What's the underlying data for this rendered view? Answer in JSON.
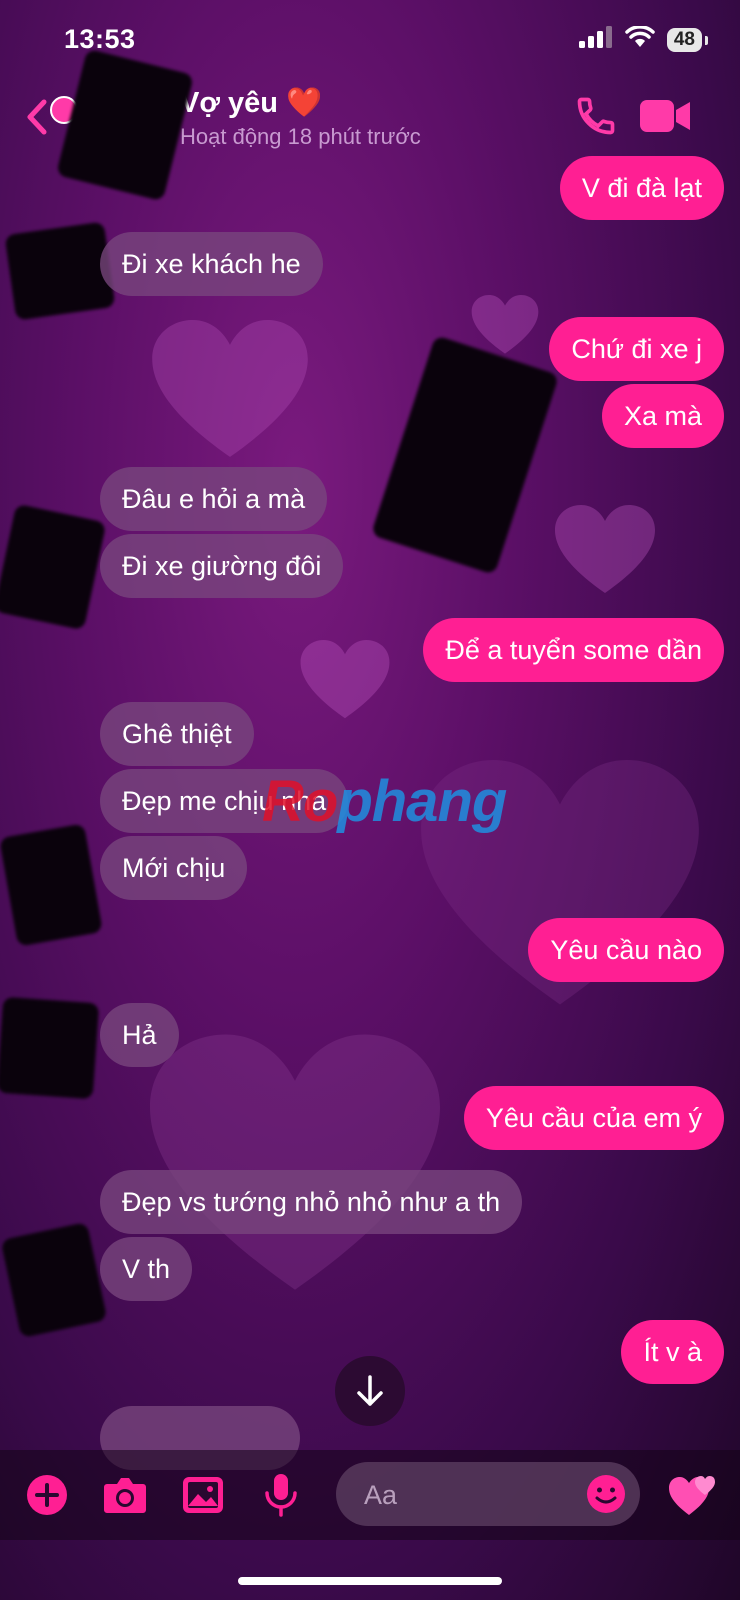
{
  "status_bar": {
    "time": "13:53",
    "battery": "48"
  },
  "header": {
    "contact_name": "Vợ yêu ❤️",
    "activity": "Hoạt động 18 phút trước"
  },
  "messages": [
    {
      "text": "V đi đà lạt",
      "direction": "out"
    },
    {
      "text": "Đi xe khách he",
      "direction": "in"
    },
    {
      "text": "Chứ đi xe j",
      "direction": "out"
    },
    {
      "text": "Xa mà",
      "direction": "out"
    },
    {
      "text": "Đâu e hỏi a mà",
      "direction": "in"
    },
    {
      "text": "Đi xe giường đôi",
      "direction": "in"
    },
    {
      "text": "Để a tuyển some dần",
      "direction": "out"
    },
    {
      "text": "Ghê thiệt",
      "direction": "in"
    },
    {
      "text": "Đẹp me chịu nha",
      "direction": "in"
    },
    {
      "text": "Mới chịu",
      "direction": "in"
    },
    {
      "text": "Yêu cầu nào",
      "direction": "out"
    },
    {
      "text": "Hả",
      "direction": "in"
    },
    {
      "text": "Yêu cầu của em ý",
      "direction": "out"
    },
    {
      "text": "Đẹp vs tướng nhỏ nhỏ như a th",
      "direction": "in"
    },
    {
      "text": "V th",
      "direction": "in"
    },
    {
      "text": "Ít v à",
      "direction": "out"
    }
  ],
  "watermark": {
    "part1": "Ro",
    "part2": "phang"
  },
  "composer": {
    "placeholder": "Aa"
  },
  "colors": {
    "accent": "#ff1f93",
    "incoming_bubble": "#78467d",
    "background": "#5b0f66"
  },
  "icons": [
    "back-icon",
    "phone-icon",
    "video-camera-icon",
    "plus-icon",
    "camera-icon",
    "image-icon",
    "microphone-icon",
    "emoji-icon",
    "hearts-icon",
    "arrow-down-icon"
  ]
}
